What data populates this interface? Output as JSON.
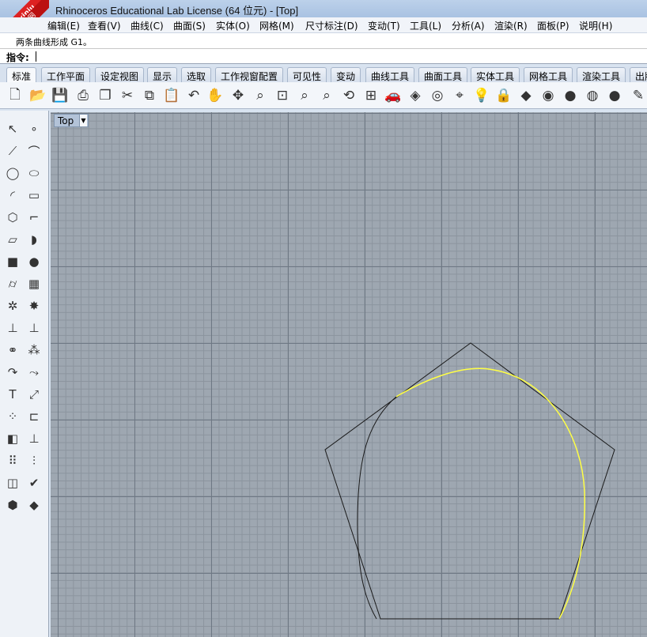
{
  "window": {
    "title": "Rhinoceros Educational Lab License (64 位元) - [Top]"
  },
  "watermark": {
    "line1": "xuexiniu",
    "line2": "学犀牛中文网"
  },
  "menu": [
    {
      "label": "编辑(E)"
    },
    {
      "label": "查看(V)"
    },
    {
      "label": "曲线(C)"
    },
    {
      "label": "曲面(S)"
    },
    {
      "label": "实体(O)"
    },
    {
      "label": "网格(M)"
    },
    {
      "label": "尺寸标注(D)"
    },
    {
      "label": "变动(T)"
    },
    {
      "label": "工具(L)"
    },
    {
      "label": "分析(A)"
    },
    {
      "label": "渲染(R)"
    },
    {
      "label": "面板(P)"
    },
    {
      "label": "说明(H)"
    }
  ],
  "command": {
    "history": "两条曲线形成 G1。",
    "prompt_label": "指令:",
    "value": ""
  },
  "tabs": [
    {
      "label": "标准",
      "active": true
    },
    {
      "label": "工作平面"
    },
    {
      "label": "设定视图"
    },
    {
      "label": "显示"
    },
    {
      "label": "选取"
    },
    {
      "label": "工作视窗配置"
    },
    {
      "label": "可见性"
    },
    {
      "label": "变动"
    },
    {
      "label": "曲线工具"
    },
    {
      "label": "曲面工具"
    },
    {
      "label": "实体工具"
    },
    {
      "label": "网格工具"
    },
    {
      "label": "渲染工具"
    },
    {
      "label": "出版"
    }
  ],
  "toolbar_icons": [
    "new-file-icon",
    "open-folder-icon",
    "save-icon",
    "print-icon",
    "import-icon",
    "cut-icon",
    "copy-icon",
    "paste-icon",
    "undo-icon",
    "pan-hand-icon",
    "rotate-view-icon",
    "zoom-dynamic-icon",
    "zoom-window-icon",
    "zoom-extents-icon",
    "zoom-selected-icon",
    "rotate-view-arrow-icon",
    "four-viewports-icon",
    "car-icon",
    "perspective-icon",
    "named-view-icon",
    "cplane-icon",
    "light-bulb-icon",
    "lock-icon",
    "layer-icon",
    "color-wheel-icon",
    "shaded-sphere-icon",
    "rendered-sphere-icon",
    "blue-sphere-icon",
    "pen-icon"
  ],
  "sidebar_icons": [
    "select-arrow-icon",
    "point-icon",
    "polyline-icon",
    "curve-control-points-icon",
    "circle-icon",
    "ellipse-icon",
    "arc-icon",
    "rectangle-icon",
    "polygon-icon",
    "fillet-curve-icon",
    "surface-corner-points-icon",
    "loft-surface-icon",
    "box-solid-icon",
    "sphere-solid-icon",
    "cylinder-icon",
    "mesh-plane-icon",
    "gear-transform-icon",
    "explode-icon",
    "trim-icon",
    "split-icon",
    "boolean-union-icon",
    "group-icon",
    "offset-curve-icon",
    "blend-curve-icon",
    "text-icon",
    "scale-icon",
    "array-icon",
    "align-icon",
    "block-icon",
    "dimension-icon",
    "grid-array-icon",
    "weld-icon",
    "extrude-icon",
    "check-icon",
    "shaded-box-icon",
    "render-icon"
  ],
  "viewport": {
    "label": "Top"
  },
  "colors": {
    "grid_major": "#6e7884",
    "grid_minor": "#8b949e",
    "viewport_bg": "#9ea7b1",
    "highlight_curve": "#ffff44",
    "curve": "#1a1a1a"
  }
}
